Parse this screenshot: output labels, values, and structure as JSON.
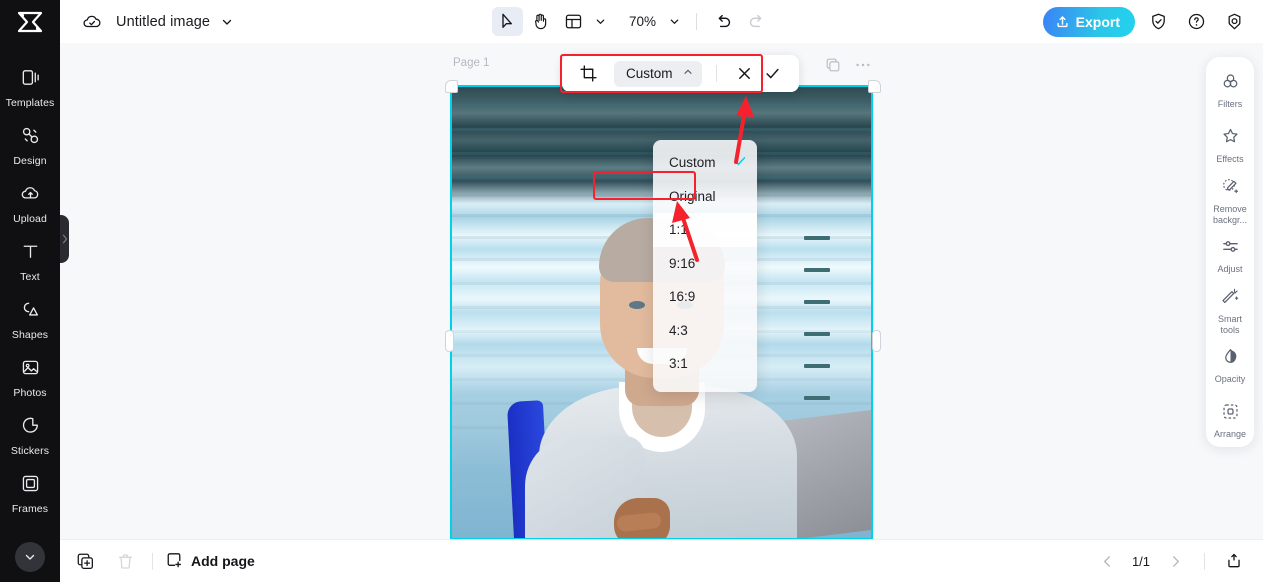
{
  "app": {
    "logo": "capcut-logo",
    "document_title": "Untitled image"
  },
  "toolbar": {
    "tools": [
      {
        "name": "select-tool",
        "icon": "cursor-arrow-icon",
        "active": true
      },
      {
        "name": "hand-tool",
        "icon": "hand-icon",
        "active": false
      },
      {
        "name": "layout-tool",
        "icon": "layout-grid-icon",
        "active": false
      }
    ],
    "zoom_level": "70%",
    "undo_label": "undo-icon",
    "redo_label": "redo-icon",
    "export_label": "Export",
    "right_icons": [
      "shield-check-icon",
      "help-circle-icon",
      "settings-icon"
    ]
  },
  "sidebar": {
    "items": [
      {
        "label": "Templates",
        "icon": "templates-icon"
      },
      {
        "label": "Design",
        "icon": "design-icon"
      },
      {
        "label": "Upload",
        "icon": "upload-cloud-icon"
      },
      {
        "label": "Text",
        "icon": "text-icon"
      },
      {
        "label": "Shapes",
        "icon": "shapes-icon"
      },
      {
        "label": "Photos",
        "icon": "photos-icon"
      },
      {
        "label": "Stickers",
        "icon": "stickers-icon"
      },
      {
        "label": "Frames",
        "icon": "frames-icon"
      }
    ],
    "collapse_icon": "chevron-down-icon"
  },
  "canvas": {
    "page_label": "Page 1",
    "page_tools": [
      {
        "name": "duplicate-page-button",
        "icon": "duplicate-icon"
      },
      {
        "name": "page-more-button",
        "icon": "more-horizontal-icon"
      }
    ]
  },
  "crop_toolbar": {
    "crop_icon": "crop-icon",
    "ratio_value": "Custom",
    "ratio_caret": "chevron-up-icon",
    "cancel_label": "close-icon",
    "confirm_label": "check-icon"
  },
  "ratio_menu": {
    "options": [
      {
        "label": "Custom",
        "selected": true,
        "highlighted": false
      },
      {
        "label": "Original",
        "selected": false,
        "highlighted": false
      },
      {
        "label": "1:1",
        "selected": false,
        "highlighted": true
      },
      {
        "label": "9:16",
        "selected": false,
        "highlighted": false
      },
      {
        "label": "16:9",
        "selected": false,
        "highlighted": false
      },
      {
        "label": "4:3",
        "selected": false,
        "highlighted": false
      },
      {
        "label": "3:1",
        "selected": false,
        "highlighted": false
      }
    ]
  },
  "right_panel": {
    "items": [
      {
        "label": "Filters",
        "icon": "filters-icon"
      },
      {
        "label": "Effects",
        "icon": "effects-icon"
      },
      {
        "label": "Remove\nbackgr...",
        "icon": "remove-background-icon"
      },
      {
        "label": "Adjust",
        "icon": "adjust-sliders-icon"
      },
      {
        "label": "Smart\ntools",
        "icon": "magic-wand-icon"
      },
      {
        "label": "Opacity",
        "icon": "opacity-drop-icon"
      },
      {
        "label": "Arrange",
        "icon": "arrange-icon"
      }
    ]
  },
  "bottombar": {
    "duplicate_icon": "duplicate-page-icon",
    "delete_icon": "trash-icon",
    "add_page_label": "Add page",
    "prev_icon": "chevron-left-icon",
    "next_icon": "chevron-right-icon",
    "page_count": "1/1",
    "export_icon": "export-tray-icon"
  },
  "colors": {
    "accent_cyan": "#00d0e8",
    "export_gradient_start": "#3b82f6",
    "export_gradient_end": "#22d3ee",
    "annotation_red": "#f5222d",
    "sidebar_dark": "#101013",
    "canvas_bg": "#f7f8fa"
  },
  "annotations": {
    "crop_bar_highlight": true,
    "ratio_1to1_highlight": true,
    "arrow_count": 2
  }
}
